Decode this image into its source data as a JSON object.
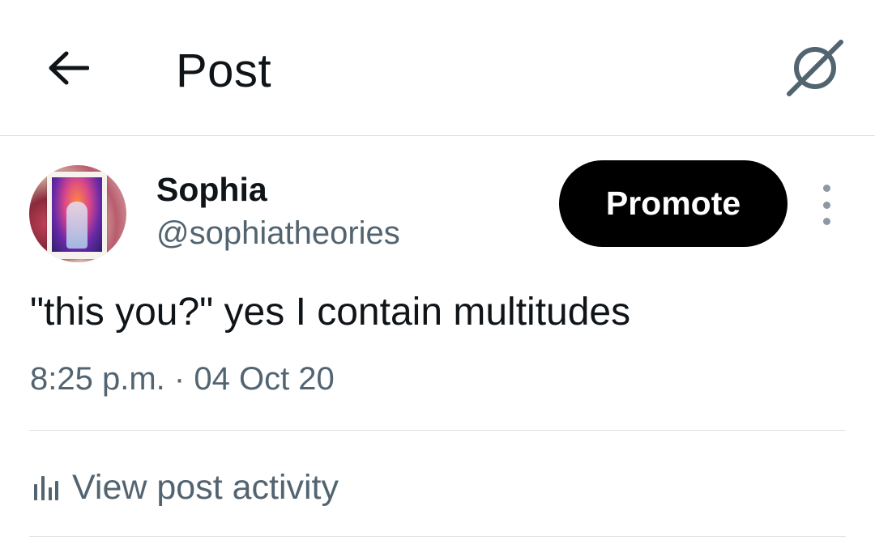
{
  "header": {
    "title": "Post",
    "back_icon": "arrow-left-icon",
    "grok_icon": "grok-icon"
  },
  "author": {
    "name": "Sophia",
    "handle": "@sophiatheories",
    "avatar_icon": "avatar"
  },
  "actions": {
    "promote_label": "Promote",
    "more_icon": "more-vertical-icon"
  },
  "post": {
    "text": "\"this you?\" yes I contain multitudes",
    "time": "8:25 p.m.",
    "separator": "·",
    "date": "04 Oct 20"
  },
  "activity": {
    "label": "View post activity",
    "icon": "bar-chart-icon"
  },
  "colors": {
    "text_primary": "#0f1419",
    "text_secondary": "#536471",
    "promote_bg": "#000000",
    "divider": "#dcdfe2"
  }
}
